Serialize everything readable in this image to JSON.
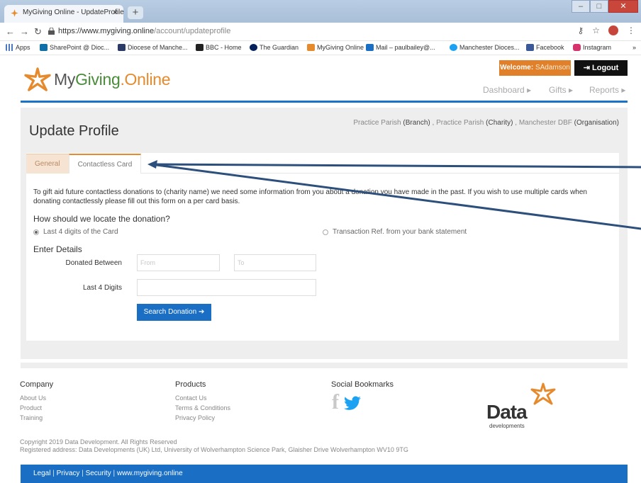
{
  "browser": {
    "tab_title": "MyGiving Online - UpdateProfile",
    "tab_close": "×",
    "new_tab": "+",
    "url_host": "https://www.mygiving.online",
    "url_path": "/account/updateprofile",
    "bookmarks": [
      "Apps",
      "SharePoint @ Dioc...",
      "Diocese of Manche...",
      "BBC - Home",
      "The Guardian",
      "MyGiving Online",
      "Mail – paulbailey@...",
      "Manchester Dioces...",
      "Facebook",
      "Instagram"
    ],
    "bookmark_overflow": "»"
  },
  "site": {
    "logo_my": "My",
    "logo_giving": "Giving",
    "logo_dot_online": ".Online",
    "welcome_label": "Welcome:",
    "welcome_user": "SAdamson",
    "logout_label": "Logout",
    "nav": [
      "Dashboard",
      "Gifts",
      "Reports"
    ]
  },
  "page": {
    "title": "Update Profile",
    "context": {
      "branch_name": "Practice Parish",
      "branch_tag": "(Branch)",
      "charity_name": "Practice Parish",
      "charity_tag": "(Charity)",
      "org_name": "Manchester DBF",
      "org_tag": "(Organisation)"
    },
    "tabs": [
      "General",
      "Contactless Card"
    ],
    "intro": "To gift aid future contactless donations to (charity name) we need some information from you about a donation you have made in the past. If you wish to use multiple cards when donating contactlessly please fill out this form on a per card basis.",
    "locate_heading": "How should we locate the donation?",
    "radio_last4": "Last 4 digits of the Card",
    "radio_txref": "Transaction Ref. from your bank statement",
    "details_heading": "Enter Details",
    "donated_between_label": "Donated Between",
    "from_placeholder": "From",
    "to_placeholder": "To",
    "last4_label": "Last 4 Digits",
    "search_button": "Search Donation"
  },
  "footer": {
    "company_heading": "Company",
    "company_links": [
      "About Us",
      "Product",
      "Training"
    ],
    "products_heading": "Products",
    "products_links": [
      "Contact Us",
      "Terms & Conditions",
      "Privacy Policy"
    ],
    "social_heading": "Social Bookmarks",
    "data_word": "Data",
    "developments_word": "developments",
    "copyright": "Copyright 2019 Data Development. All Rights Reserved",
    "address": "Registered address: Data Developments (UK) Ltd, University of Wolverhampton Science Park, Glaisher Drive Wolverhampton WV10 9TG",
    "bottom_links": [
      "Legal",
      "Privacy",
      "Security",
      "www.mygiving.online"
    ]
  },
  "colors": {
    "brand_orange": "#e68a2e",
    "brand_green": "#4a8b3a",
    "brand_blue": "#1a6fc4"
  }
}
